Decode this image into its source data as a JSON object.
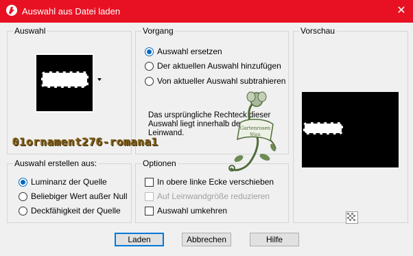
{
  "window": {
    "title": "Auswahl aus Datei laden",
    "close_glyph": "✕"
  },
  "groups": {
    "selection": {
      "title": "Auswahl"
    },
    "operation": {
      "title": "Vorgang",
      "options": [
        {
          "label": "Auswahl ersetzen",
          "checked": true
        },
        {
          "label": "Der aktuellen Auswahl hinzufügen",
          "checked": false
        },
        {
          "label": "Von aktueller Auswahl subtrahieren",
          "checked": false
        }
      ],
      "info": "Das ursprüngliche Rechteck dieser Auswahl liegt innerhalb der Leinwand."
    },
    "preview": {
      "title": "Vorschau"
    },
    "create_from": {
      "title": "Auswahl erstellen aus:",
      "options": [
        {
          "label": "Luminanz der Quelle",
          "checked": true
        },
        {
          "label": "Beliebiger Wert außer Null",
          "checked": false
        },
        {
          "label": "Deckfähigkeit der Quelle",
          "checked": false
        }
      ]
    },
    "options": {
      "title": "Optionen",
      "items": [
        {
          "label": "In obere linke Ecke verschieben",
          "checked": false,
          "disabled": false
        },
        {
          "label": "Auf Leinwandgröße reduzieren",
          "checked": false,
          "disabled": true
        },
        {
          "label": "Auswahl umkehren",
          "checked": false,
          "disabled": false
        }
      ]
    }
  },
  "buttons": {
    "load": "Laden",
    "cancel": "Abbrechen",
    "help": "Hilfe"
  },
  "overlay": {
    "file_name": "01ornament276-romana1",
    "ornament_text_line1": "Gartenrosen",
    "ornament_text_line2": "Wien"
  },
  "colors": {
    "titlebar": "#e81123",
    "accent": "#0067c0",
    "watermark": "#7a5a1c",
    "ornament": "#4f6b3a"
  },
  "icons": {
    "app": "paintshop-icon",
    "close": "close-icon",
    "dropdown": "chevron-down-icon",
    "checker": "transparency-checker-icon"
  }
}
